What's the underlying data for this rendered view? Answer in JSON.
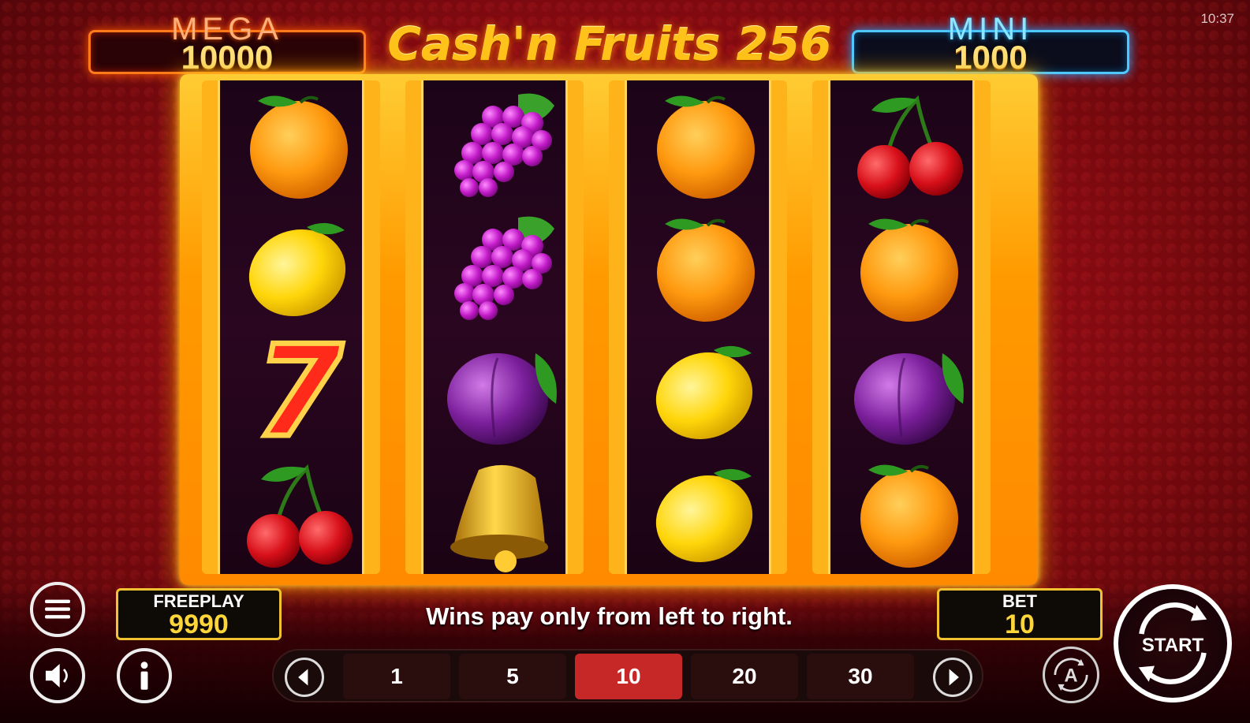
{
  "jackpots": {
    "mega": {
      "label": "MEGA",
      "value": "10000"
    },
    "mini": {
      "label": "MINI",
      "value": "1000"
    }
  },
  "title": "Cash'n Fruits 256",
  "clock": "10:37",
  "reels": [
    [
      "orange",
      "lemon",
      "seven",
      "cherry"
    ],
    [
      "grapes",
      "grapes",
      "plum",
      "bell"
    ],
    [
      "orange",
      "orange",
      "lemon",
      "lemon"
    ],
    [
      "cherry",
      "orange",
      "plum",
      "orange"
    ]
  ],
  "freeplay": {
    "label": "FREEPLAY",
    "value": "9990"
  },
  "bet": {
    "label": "BET",
    "value": "10"
  },
  "message": "Wins pay only from left to right.",
  "bet_options": [
    "1",
    "5",
    "10",
    "20",
    "30"
  ],
  "selected_bet": "10",
  "start_label": "START",
  "icons": {
    "menu": "menu-icon",
    "sound": "speaker-icon",
    "info": "info-icon",
    "autoplay": "autoplay-icon",
    "prev": "arrow-left-icon",
    "next": "arrow-right-icon"
  },
  "colors": {
    "background": "#8e0b12",
    "reel_frame": "#ffb31a",
    "selected_bet": "#c62828",
    "value_text": "#ffd63a"
  }
}
